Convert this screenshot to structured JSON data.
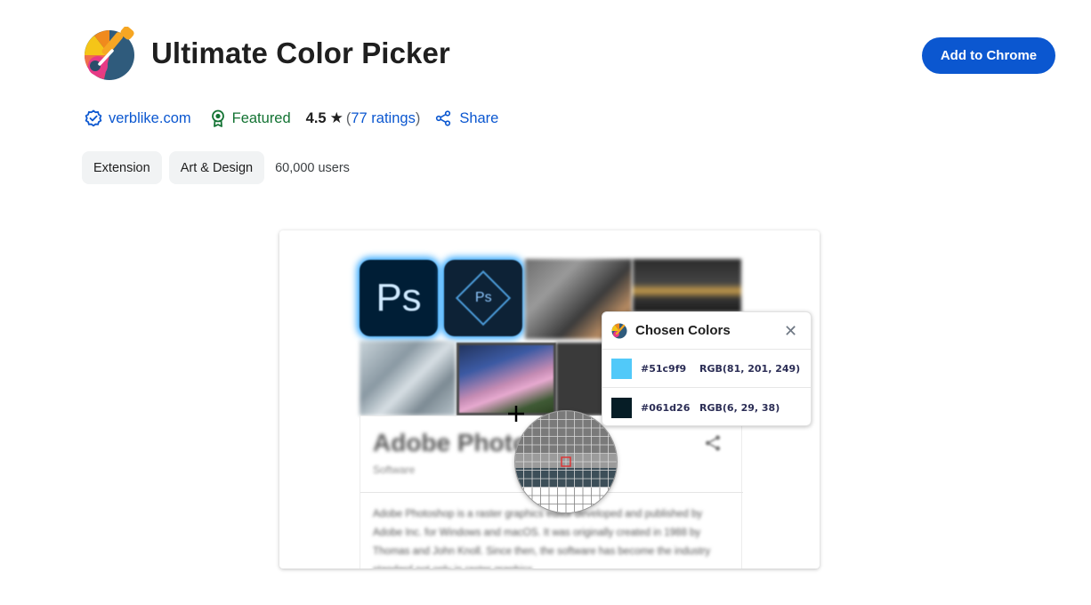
{
  "header": {
    "title": "Ultimate Color Picker",
    "add_button": "Add to Chrome"
  },
  "meta": {
    "publisher": "verblike.com",
    "featured": "Featured",
    "rating": "4.5",
    "ratings_text": "77 ratings",
    "share": "Share"
  },
  "tags": {
    "category1": "Extension",
    "category2": "Art & Design",
    "users": "60,000 users"
  },
  "screenshot": {
    "ps_label": "Ps",
    "ps_label_small": "Ps",
    "panel_title": "Adobe Photos",
    "panel_subtitle": "Software",
    "panel_text": "Adobe Photoshop is a raster graphics editor developed and published by Adobe Inc. for Windows and macOS. It was originally created in 1988 by Thomas and John Knoll. Since then, the software has become the industry standard not only in raster graphics",
    "popup": {
      "title": "Chosen Colors",
      "close": "✕",
      "colors": [
        {
          "hex": "#51c9f9",
          "rgb": "RGB(81, 201, 249)",
          "swatch": "#51c9f9"
        },
        {
          "hex": "#061d26",
          "rgb": "RGB(6, 29, 38)",
          "swatch": "#061d26"
        }
      ]
    }
  },
  "colors": {
    "accent": "#0b57d0",
    "featured": "#137333",
    "chip_bg": "#f1f3f4"
  },
  "icons": {
    "verified": "verified-badge-icon",
    "featured": "award-ribbon-icon",
    "star": "star-icon",
    "share": "share-icon",
    "logo": "color-picker-logo-icon",
    "close": "close-icon"
  }
}
